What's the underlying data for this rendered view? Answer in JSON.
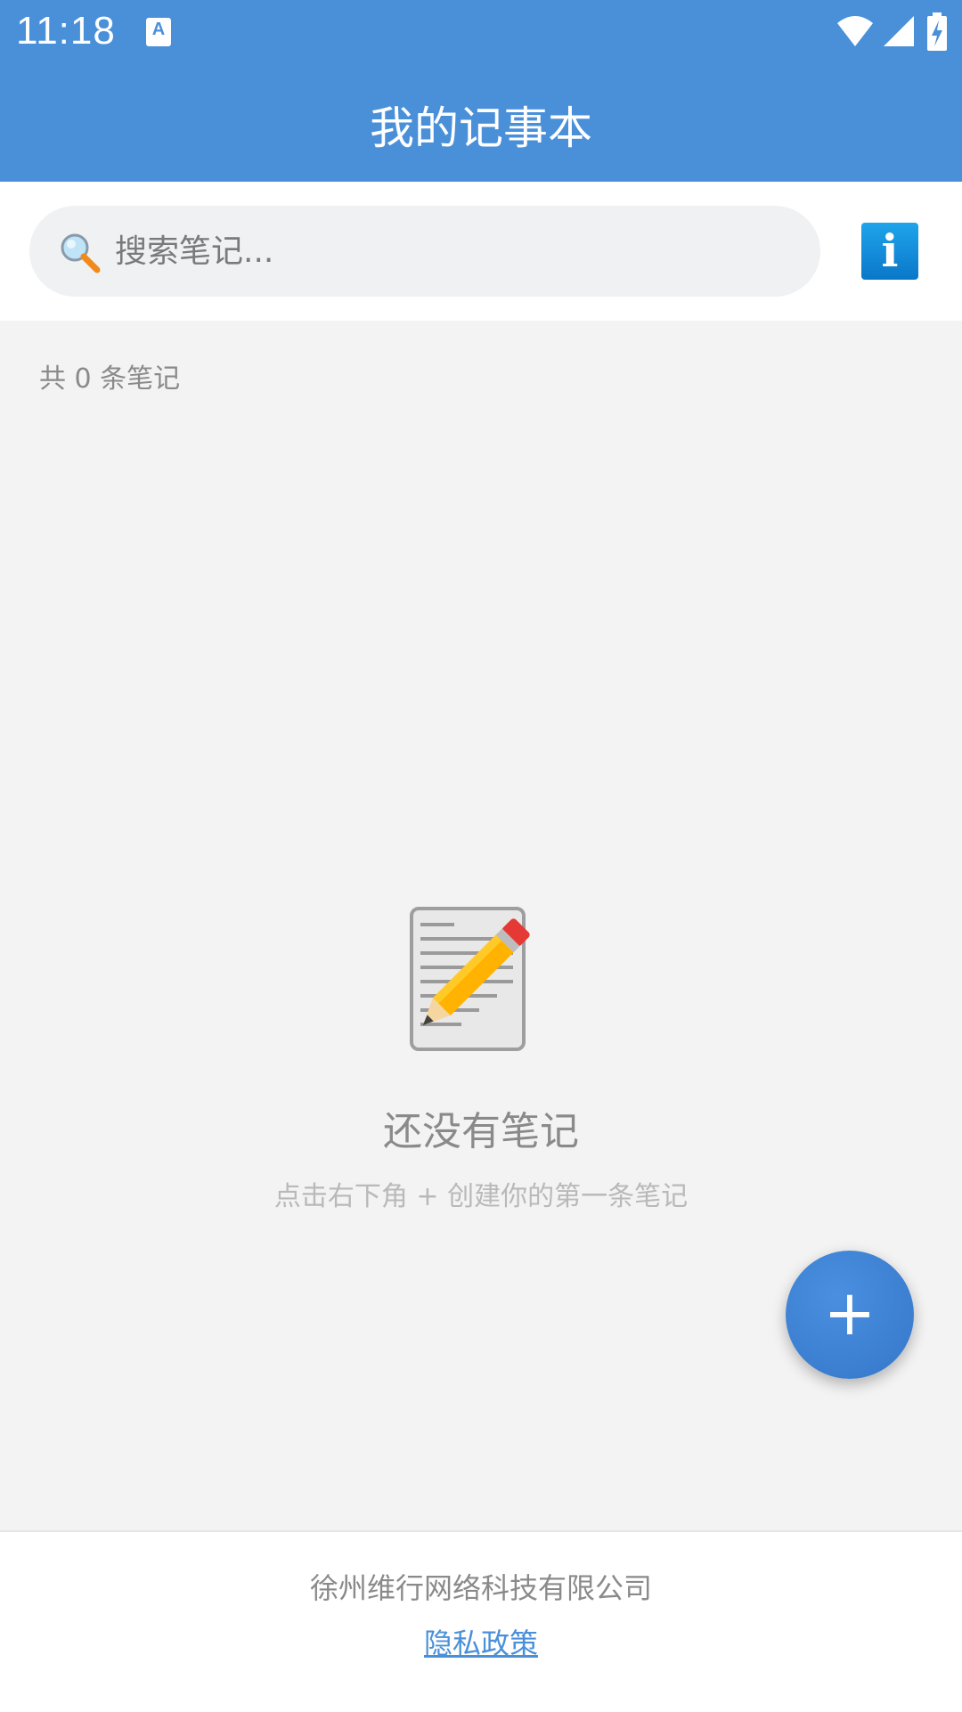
{
  "status_bar": {
    "time": "11:18",
    "notification_icon": "A",
    "icons": [
      "wifi-icon",
      "signal-icon",
      "battery-charging-icon"
    ]
  },
  "header": {
    "title": "我的记事本"
  },
  "search": {
    "placeholder": "搜索笔记...",
    "value": "",
    "icon": "search-icon"
  },
  "info_button": {
    "label": "i",
    "icon": "info-icon"
  },
  "notes": {
    "count_label": "共 0 条笔记"
  },
  "empty_state": {
    "illustration": "memo-pencil-icon",
    "title": "还没有笔记",
    "hint": "点击右下角 + 创建你的第一条笔记"
  },
  "fab": {
    "label": "+"
  },
  "footer": {
    "company": "徐州维行网络科技有限公司",
    "privacy_link": "隐私政策"
  },
  "colors": {
    "primary": "#4a90d9",
    "background": "#f3f3f3",
    "fab": "#3a7fd2"
  }
}
